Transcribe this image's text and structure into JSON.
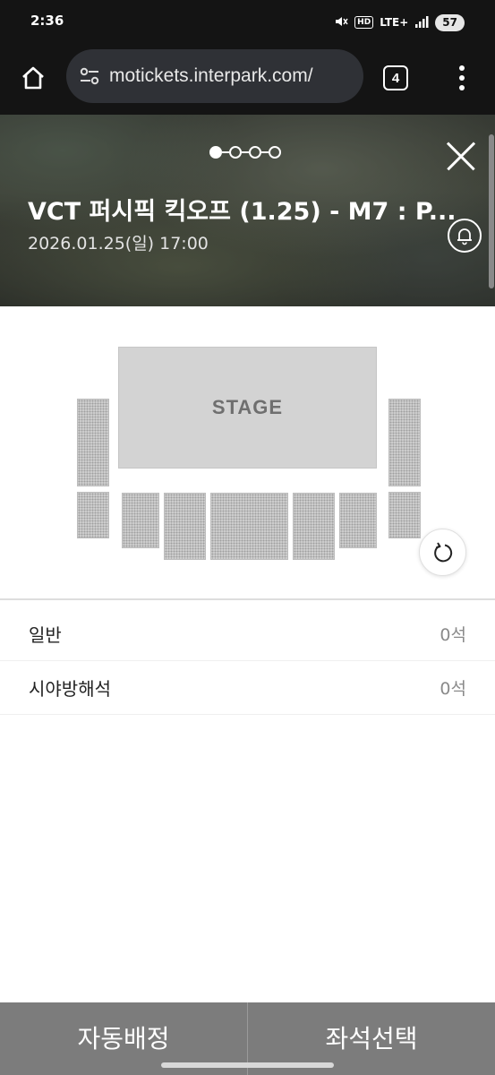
{
  "status_bar": {
    "time": "2:36",
    "hd_label": "HD",
    "network_label": "LTE+",
    "battery": "57"
  },
  "browser": {
    "url": "motickets.interpark.com/",
    "tab_count": "4"
  },
  "header": {
    "pager": {
      "total": 4,
      "active": 1
    },
    "title": "VCT 퍼시픽 킥오프 (1.25) - M7 : P...",
    "datetime": "2026.01.25(일) 17:00"
  },
  "seat_map": {
    "stage_label": "STAGE",
    "stage_color": "#d3d3d3",
    "block_color": "#cfcfcf"
  },
  "seat_grades": [
    {
      "name": "일반",
      "count": "0석"
    },
    {
      "name": "시야방해석",
      "count": "0석"
    }
  ],
  "actions": {
    "auto_assign": "자동배정",
    "select_seat": "좌석선택",
    "bar_color": "#7c7c7c"
  }
}
